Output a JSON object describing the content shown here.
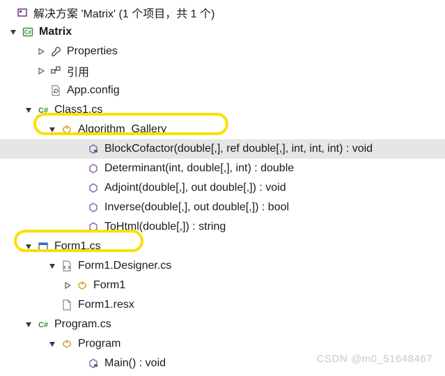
{
  "solution": {
    "label": "解决方案 'Matrix' (1 个项目，共 1 个)",
    "project": "Matrix",
    "properties": "Properties",
    "references": "引用",
    "appconfig": "App.config"
  },
  "class1": {
    "file": "Class1.cs",
    "class_name": "Algorithm_Gallery",
    "methods": {
      "m0": "BlockCofactor(double[,], ref double[,], int, int, int) : void",
      "m1": "Determinant(int, double[,], int) : double",
      "m2": "Adjoint(double[,], out double[,]) : void",
      "m3": "Inverse(double[,], out double[,]) : bool",
      "m4": "ToHtml(double[,]) : string"
    }
  },
  "form1": {
    "file": "Form1.cs",
    "designer": "Form1.Designer.cs",
    "class_name": "Form1",
    "resx": "Form1.resx"
  },
  "program": {
    "file": "Program.cs",
    "class_name": "Program",
    "main": "Main() : void"
  },
  "watermark": "CSDN @m0_51648467"
}
